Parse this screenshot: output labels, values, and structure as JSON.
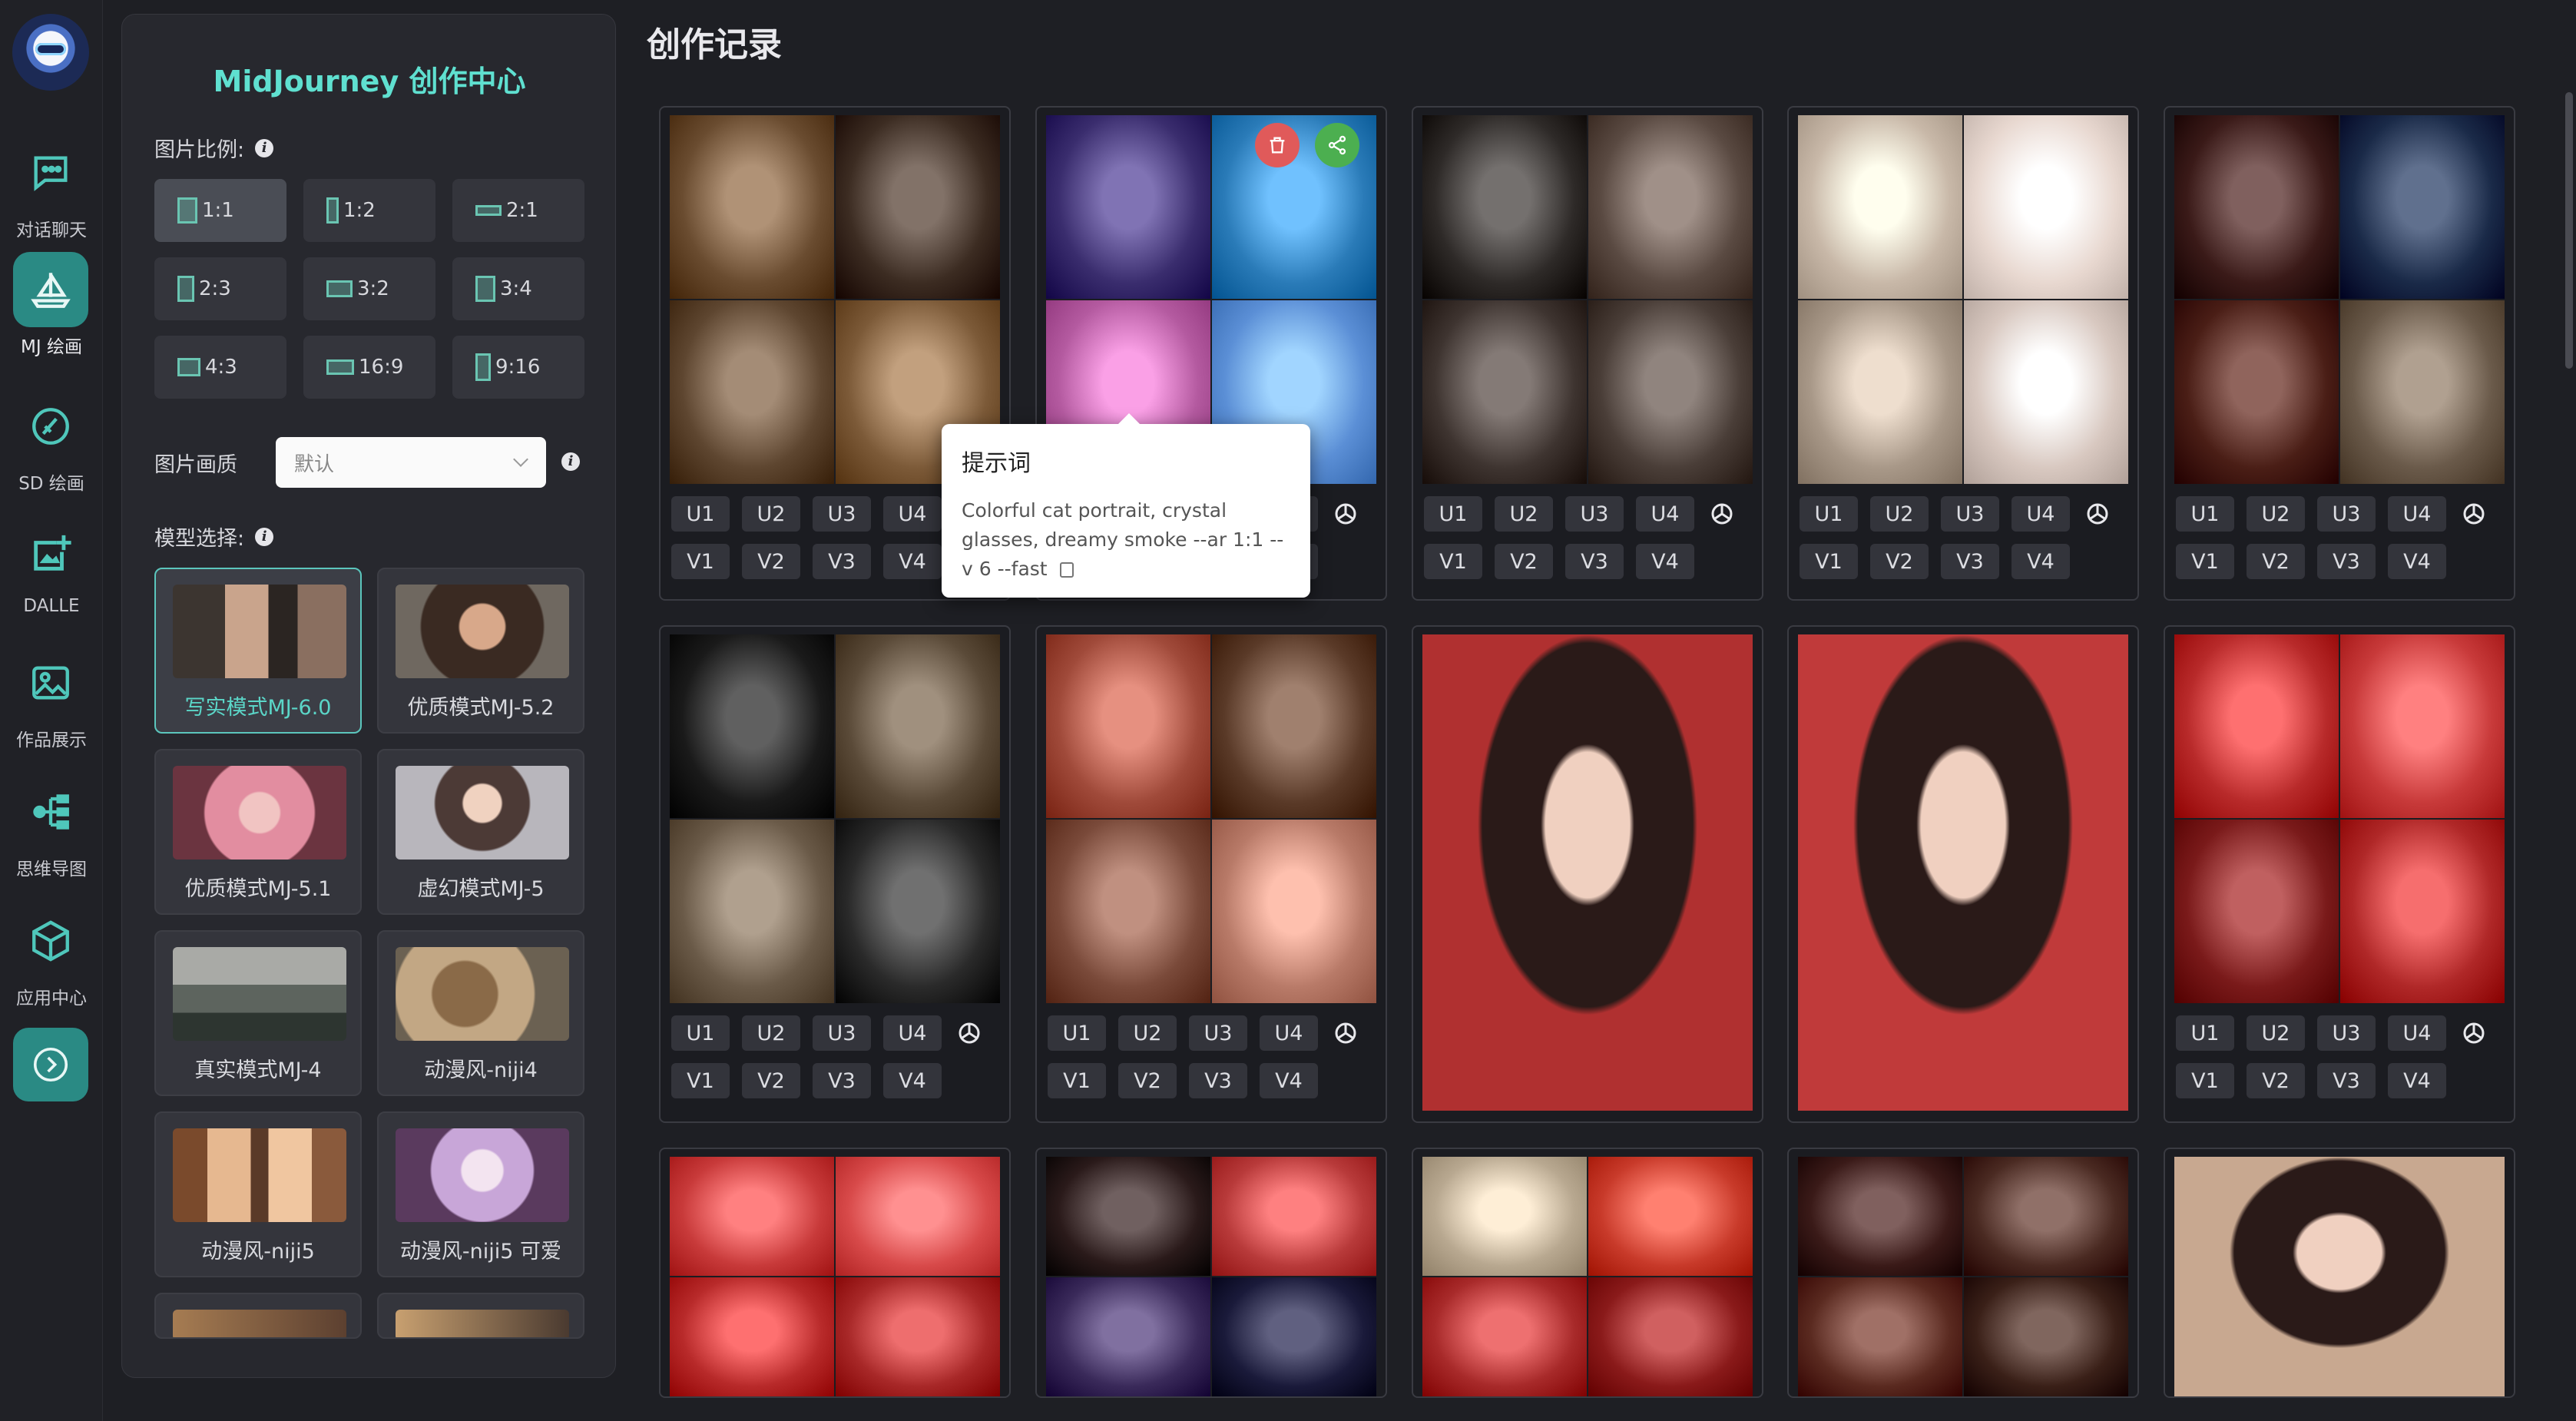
{
  "rail": {
    "items": [
      {
        "label": "对话聊天",
        "icon": "chat-icon",
        "active": false
      },
      {
        "label": "MJ 绘画",
        "icon": "sailboat-icon",
        "active": true
      },
      {
        "label": "SD 绘画",
        "icon": "brush-icon",
        "active": false
      },
      {
        "label": "DALLE",
        "icon": "image-add-icon",
        "active": false
      },
      {
        "label": "作品展示",
        "icon": "gallery-icon",
        "active": false
      },
      {
        "label": "思维导图",
        "icon": "mindmap-icon",
        "active": false
      },
      {
        "label": "应用中心",
        "icon": "cube-icon",
        "active": false
      }
    ]
  },
  "panel": {
    "title": "MidJourney 创作中心",
    "ratio_label": "图片比例:",
    "ratios": [
      "1:1",
      "1:2",
      "2:1",
      "2:3",
      "3:2",
      "3:4",
      "4:3",
      "16:9",
      "9:16"
    ],
    "selected_ratio": "1:1",
    "quality_label": "图片画质",
    "quality_value": "默认",
    "model_label": "模型选择:",
    "models": [
      "写实模式MJ-6.0",
      "优质模式MJ-5.2",
      "优质模式MJ-5.1",
      "虚幻模式MJ-5",
      "真实模式MJ-4",
      "动漫风-niji4",
      "动漫风-niji5",
      "动漫风-niji5 可爱"
    ],
    "selected_model": "写实模式MJ-6.0"
  },
  "main": {
    "title": "创作记录",
    "upscale_buttons": [
      "U1",
      "U2",
      "U3",
      "U4"
    ],
    "variation_buttons": [
      "V1",
      "V2",
      "V3",
      "V4"
    ],
    "tooltip": {
      "title": "提示词",
      "text": "Colorful cat portrait, crystal glasses, dreamy smoke --ar 1:1 --v 6 --fast"
    }
  },
  "colors": {
    "accent": "#2a8a84",
    "title_accent": "#5fe0d0",
    "delete": "#e05a5a",
    "share": "#4caf50"
  }
}
